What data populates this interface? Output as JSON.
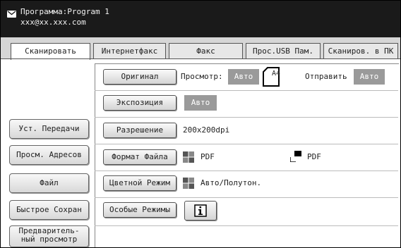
{
  "header": {
    "program": "Программа:Program 1",
    "address": "xxx@xx.xxx.com",
    "icon": "mail-icon"
  },
  "tabs": [
    {
      "label": "Сканировать",
      "active": true
    },
    {
      "label": "Интернетфакс",
      "active": false
    },
    {
      "label": "Факс",
      "active": false
    },
    {
      "label": "Прос.USB Пам.",
      "active": false
    },
    {
      "label": "Сканиров. в ПК",
      "active": false
    }
  ],
  "sidebar": {
    "transfer": "Уст. Передачи",
    "address_review": "Просм. Адресов",
    "file": "Файл",
    "quick_save": "Быстрое Сохран",
    "preview_l1": "Предваритель-",
    "preview_l2": "ный просмотр"
  },
  "main": {
    "original": {
      "button": "Оригинал",
      "preview_label": "Просмотр:",
      "preview_value": "Авто",
      "paper": "A4",
      "send_label": "Отправить",
      "send_value": "Авто"
    },
    "exposure": {
      "button": "Экспозиция",
      "value": "Авто"
    },
    "resolution": {
      "button": "Разрешение",
      "value": "200x200dpi"
    },
    "file_format": {
      "button": "Формат Файла",
      "value_left": "PDF",
      "value_right": "PDF"
    },
    "color_mode": {
      "button": "Цветной Режим",
      "value": "Авто/Полутон."
    },
    "special_modes": {
      "button": "Особые Режимы",
      "info_icon": "info-icon"
    }
  }
}
